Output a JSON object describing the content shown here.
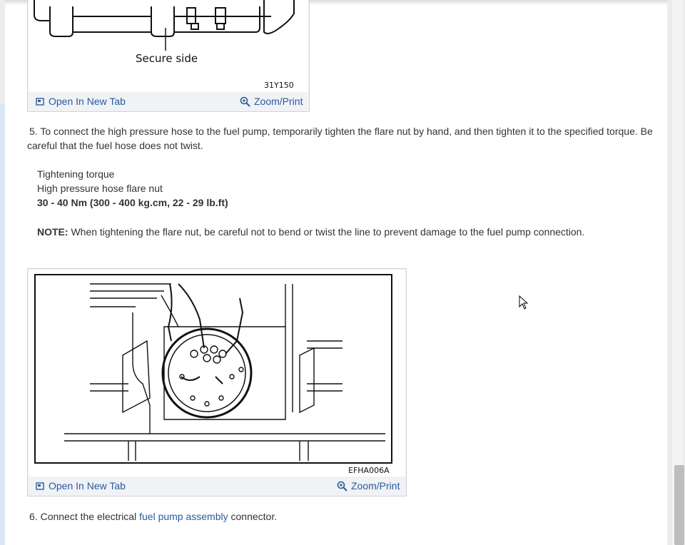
{
  "figure1": {
    "label": "Secure side",
    "code": "31Y150",
    "open_tab": "Open In New Tab",
    "zoom": "Zoom/Print"
  },
  "step5": {
    "number": "5.",
    "text": "To connect the high pressure hose to the fuel pump, temporarily tighten the flare nut by hand, and then tighten it to the specified torque. Be careful that the fuel hose does not twist.",
    "torque_heading": "Tightening torque",
    "torque_item": "High pressure hose flare nut",
    "torque_value": "30 - 40 Nm (300 - 400 kg.cm, 22 - 29 lb.ft)",
    "note_label": "NOTE:",
    "note_text": "When tightening the flare nut, be careful not to bend or twist the line to prevent damage to the fuel pump connection."
  },
  "figure2": {
    "code": "EFHA006A",
    "open_tab": "Open In New Tab",
    "zoom": "Zoom/Print"
  },
  "step6": {
    "number": "6.",
    "before": "Connect the electrical",
    "link": "fuel pump assembly",
    "after": "connector."
  },
  "icons": [
    "open-tab-icon",
    "zoom-icon",
    "mouse-cursor-icon"
  ],
  "colors": {
    "link": "#2a5a9c",
    "text": "#333333",
    "figure_bg": "#f0f2f5"
  }
}
